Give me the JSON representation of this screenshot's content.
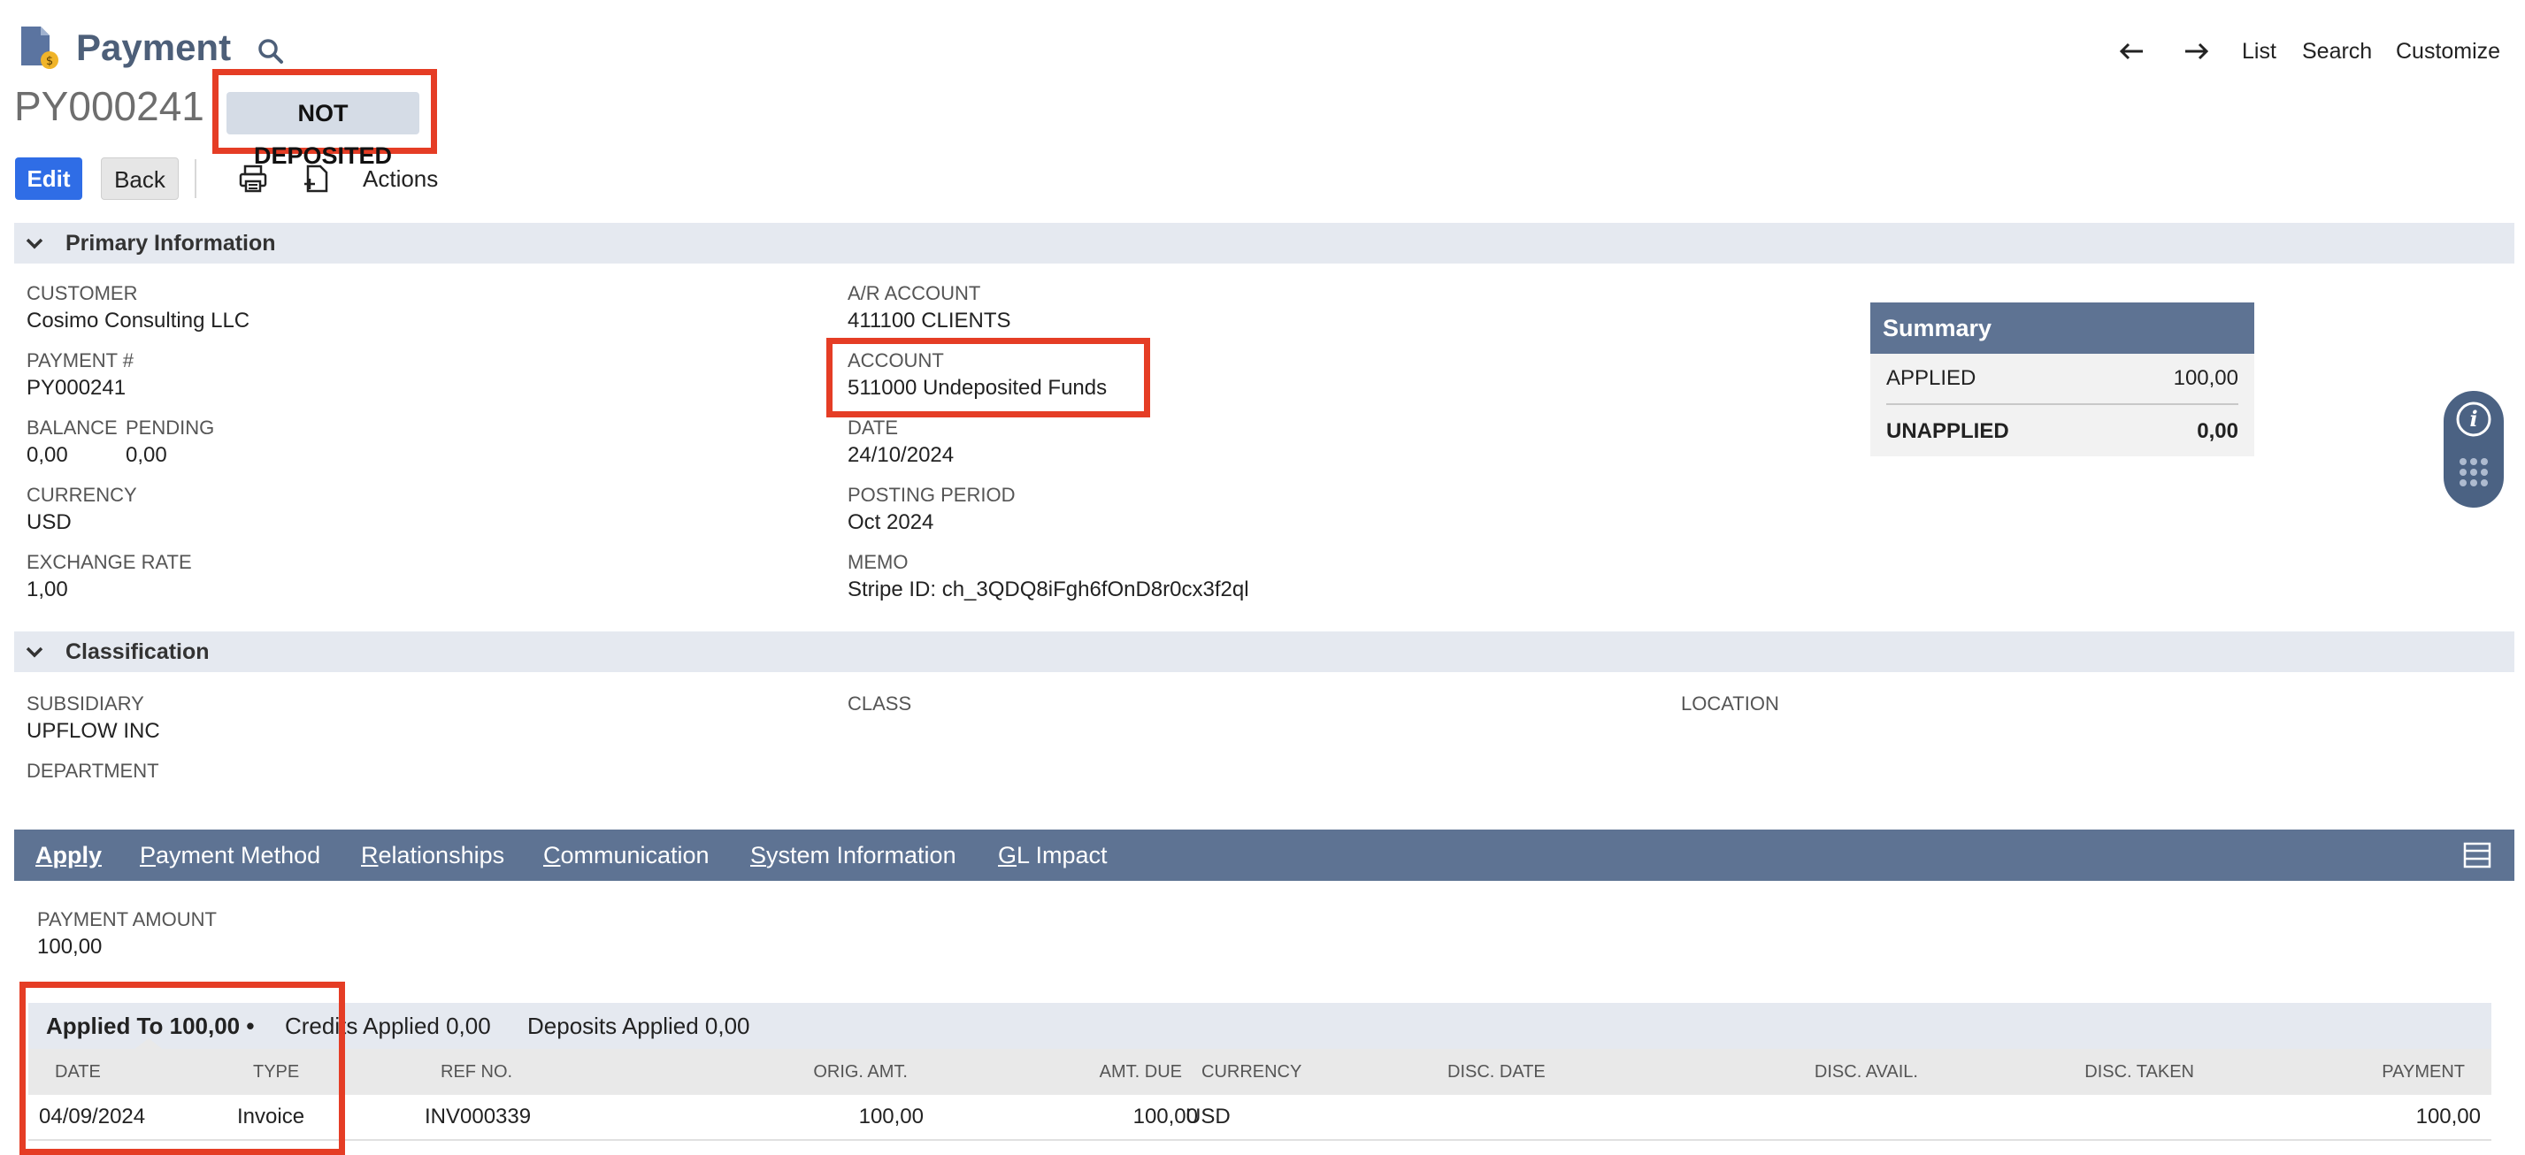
{
  "header": {
    "title": "Payment",
    "record_id": "PY000241",
    "status": "NOT DEPOSITED",
    "nav": {
      "list": "List",
      "search": "Search",
      "customize": "Customize"
    }
  },
  "toolbar": {
    "edit": "Edit",
    "back": "Back",
    "actions": "Actions"
  },
  "primary": {
    "section_title": "Primary Information",
    "customer_label": "CUSTOMER",
    "customer_value": "Cosimo Consulting LLC",
    "payment_no_label": "PAYMENT #",
    "payment_no_value": "PY000241",
    "balance_label": "BALANCE",
    "balance_value": "0,00",
    "pending_label": "PENDING",
    "pending_value": "0,00",
    "currency_label": "CURRENCY",
    "currency_value": "USD",
    "exchange_label": "EXCHANGE RATE",
    "exchange_value": "1,00",
    "ar_label": "A/R ACCOUNT",
    "ar_value": "411100 CLIENTS",
    "account_label": "ACCOUNT",
    "account_value": "511000 Undeposited Funds",
    "date_label": "DATE",
    "date_value": "24/10/2024",
    "period_label": "POSTING PERIOD",
    "period_value": "Oct 2024",
    "memo_label": "MEMO",
    "memo_value": "Stripe ID: ch_3QDQ8iFgh6fOnD8r0cx3f2ql"
  },
  "summary": {
    "title": "Summary",
    "applied_label": "APPLIED",
    "applied_value": "100,00",
    "unapplied_label": "UNAPPLIED",
    "unapplied_value": "0,00"
  },
  "classification": {
    "section_title": "Classification",
    "subsidiary_label": "SUBSIDIARY",
    "subsidiary_value": "UPFLOW INC",
    "department_label": "DEPARTMENT",
    "class_label": "CLASS",
    "location_label": "LOCATION"
  },
  "tabs": [
    {
      "first": "A",
      "rest": "pply"
    },
    {
      "first": "P",
      "rest": "ayment Method"
    },
    {
      "first": "R",
      "rest": "elationships"
    },
    {
      "first": "C",
      "rest": "ommunication"
    },
    {
      "first": "S",
      "rest": "ystem Information"
    },
    {
      "first": "G",
      "rest": "L Impact"
    }
  ],
  "apply": {
    "amount_label": "PAYMENT AMOUNT",
    "amount_value": "100,00",
    "subtabs": {
      "applied_to": "Applied To 100,00",
      "credits": "Credits Applied 0,00",
      "deposits": "Deposits Applied 0,00"
    },
    "columns": [
      "DATE",
      "TYPE",
      "REF NO.",
      "ORIG. AMT.",
      "AMT. DUE",
      "CURRENCY",
      "DISC. DATE",
      "DISC. AVAIL.",
      "DISC. TAKEN",
      "PAYMENT"
    ],
    "rows": [
      {
        "date": "04/09/2024",
        "type": "Invoice",
        "ref": "INV000339",
        "orig": "100,00",
        "due": "100,00",
        "currency": "USD",
        "payment": "100,00"
      }
    ]
  }
}
